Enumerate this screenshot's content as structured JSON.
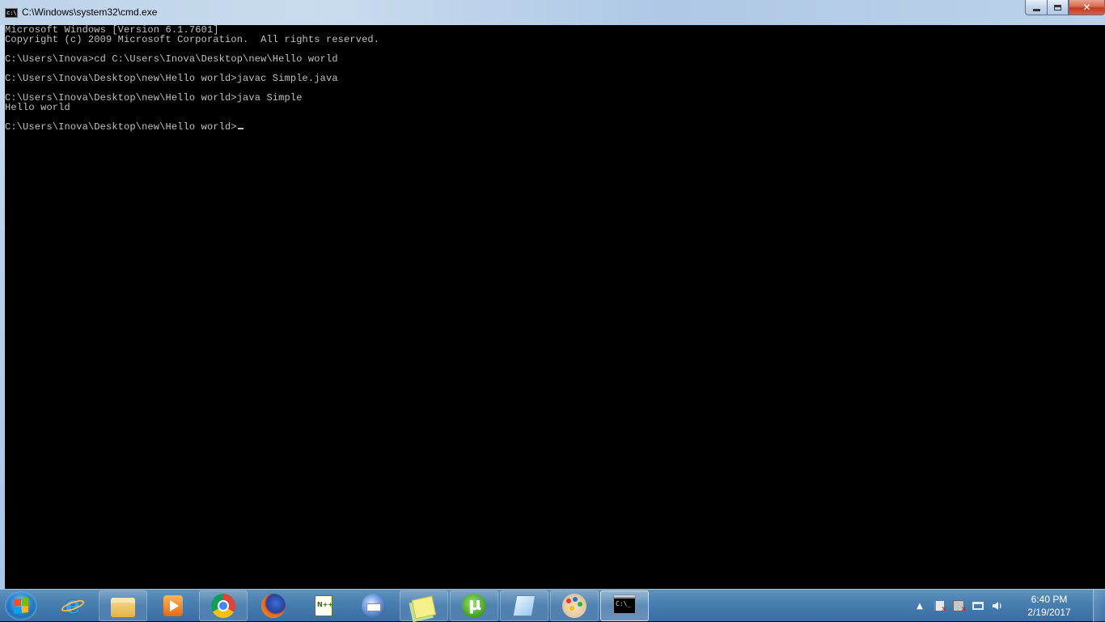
{
  "window": {
    "title": "C:\\Windows\\system32\\cmd.exe",
    "icon": "cmd-window-icon",
    "controls": {
      "minimize": "minimize",
      "maximize": "maximize",
      "close": "✕"
    }
  },
  "console": {
    "lines": [
      "Microsoft Windows [Version 6.1.7601]",
      "Copyright (c) 2009 Microsoft Corporation.  All rights reserved.",
      "",
      "C:\\Users\\Inova>cd C:\\Users\\Inova\\Desktop\\new\\Hello world",
      "",
      "C:\\Users\\Inova\\Desktop\\new\\Hello world>javac Simple.java",
      "",
      "C:\\Users\\Inova\\Desktop\\new\\Hello world>java Simple",
      "Hello world",
      "",
      "C:\\Users\\Inova\\Desktop\\new\\Hello world>"
    ],
    "colors": {
      "background": "#000000",
      "foreground": "#c0c0c0"
    }
  },
  "taskbar": {
    "start_icon": "windows-start-orb",
    "pinned": [
      {
        "name": "internet-explorer-icon",
        "glyph": "e"
      },
      {
        "name": "file-explorer-icon",
        "glyph": ""
      },
      {
        "name": "media-player-icon",
        "glyph": ""
      },
      {
        "name": "chrome-icon",
        "glyph": ""
      },
      {
        "name": "firefox-icon",
        "glyph": ""
      },
      {
        "name": "notepad-plus-plus-icon",
        "glyph": ""
      },
      {
        "name": "thunderbird-icon",
        "glyph": ""
      },
      {
        "name": "sticky-notes-icon",
        "glyph": ""
      },
      {
        "name": "utorrent-icon",
        "glyph": ""
      },
      {
        "name": "snipping-tool-icon",
        "glyph": ""
      },
      {
        "name": "paint-icon",
        "glyph": ""
      },
      {
        "name": "cmd-icon",
        "glyph": "C:\\_"
      }
    ],
    "tray": {
      "arrow": "▲",
      "clock_time": "6:40 PM",
      "clock_date": "2/19/2017"
    }
  }
}
